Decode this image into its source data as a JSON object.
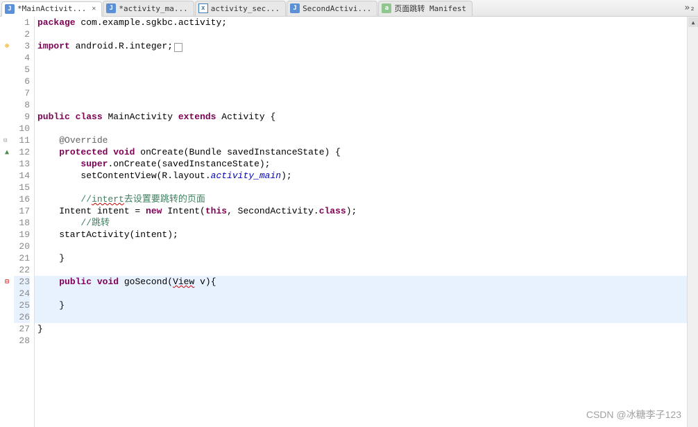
{
  "tabs": [
    {
      "label": "*MainActivit...",
      "icon": "java",
      "active": true,
      "close": true
    },
    {
      "label": "*activity_ma...",
      "icon": "java",
      "active": false
    },
    {
      "label": "activity_sec...",
      "icon": "xml",
      "active": false
    },
    {
      "label": "SecondActivi...",
      "icon": "java",
      "active": false
    },
    {
      "label": "页面跳转 Manifest",
      "icon": "manifest",
      "active": false
    }
  ],
  "tab_overflow": "»₂",
  "line_start": 1,
  "line_count": 28,
  "gutter": {
    "3": "warn-plus",
    "11": "fold",
    "12": "arrow-up",
    "23": "err-fold"
  },
  "code": {
    "l1_pkg": "package",
    "l1_rest": " com.example.sgkbc.activity;",
    "l3_import": "import",
    "l3_rest": " android.R.integer;",
    "l9_public": "public",
    "l9_class": "class",
    "l9_name": " MainActivity ",
    "l9_extends": "extends",
    "l9_type": " Activity {",
    "l11_anno": "@Override",
    "l12_prot": "protected",
    "l12_void": "void",
    "l12_rest": " onCreate(Bundle savedInstanceState) {",
    "l13_super": "super",
    "l13_rest": ".onCreate(savedInstanceState);",
    "l14_a": "        setContentView(R.layout.",
    "l14_ital": "activity_main",
    "l14_b": ");",
    "l16_a": "        //",
    "l16_ident": "intert",
    "l16_zh": "去设置要跳转的页面",
    "l17_a": "    Intent intent = ",
    "l17_new": "new",
    "l17_b": " Intent(",
    "l17_this": "this",
    "l17_c": ", SecondActivity.",
    "l17_class": "class",
    "l17_d": ");",
    "l18_comment": "        //跳转",
    "l19": "    startActivity(intent);",
    "l21": "    }",
    "l23_a": "    ",
    "l23_public": "public",
    "l23_void": "void",
    "l23_b": " goSecond(",
    "l23_view": "View",
    "l23_c": " v){",
    "l25": "    }",
    "l27": "}"
  },
  "highlight_lines": [
    23,
    24,
    25,
    26
  ],
  "watermark": "CSDN @冰糖李子123"
}
